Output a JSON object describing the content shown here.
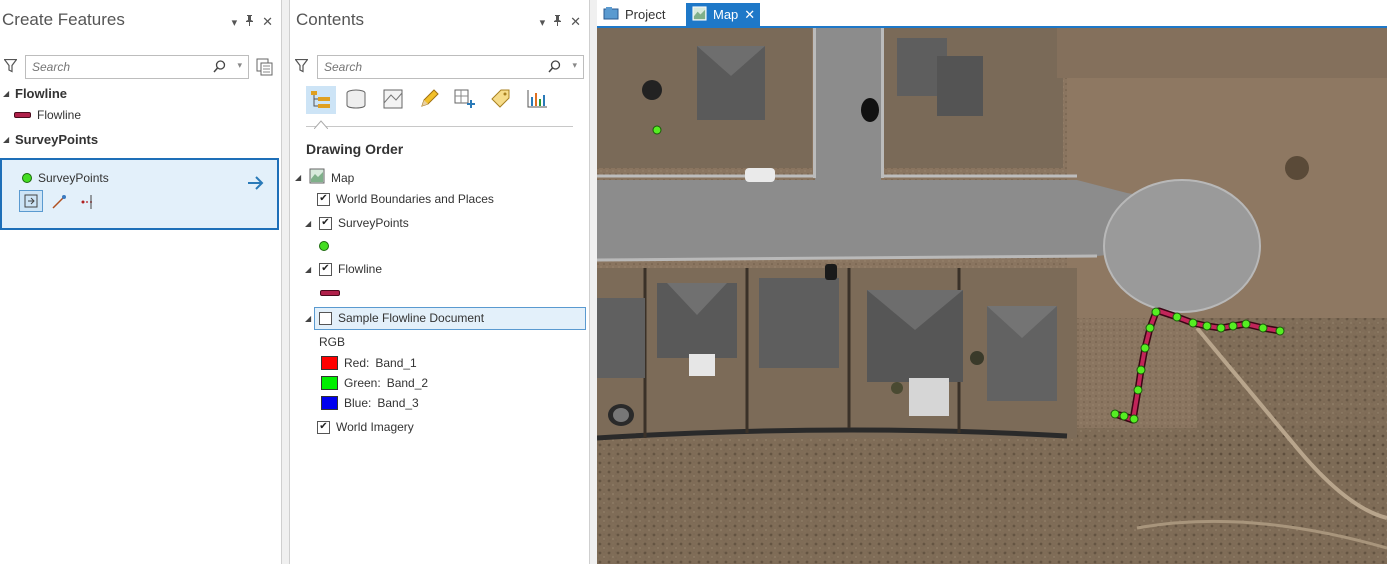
{
  "create_features": {
    "title": "Create Features",
    "search_placeholder": "Search",
    "groups": [
      {
        "name": "Flowline",
        "items": [
          "Flowline"
        ]
      },
      {
        "name": "SurveyPoints"
      }
    ],
    "selected_template": "SurveyPoints"
  },
  "contents": {
    "title": "Contents",
    "search_placeholder": "Search",
    "section": "Drawing Order",
    "map_label": "Map",
    "layers": {
      "world_boundaries": "World Boundaries and Places",
      "survey_points": "SurveyPoints",
      "flowline": "Flowline",
      "sample_doc": "Sample Flowline Document",
      "rgb_label": "RGB",
      "bands": [
        {
          "channel": "Red:",
          "band": "Band_1",
          "color": "#ff0000"
        },
        {
          "channel": "Green:",
          "band": "Band_2",
          "color": "#00ee00"
        },
        {
          "channel": "Blue:",
          "band": "Band_3",
          "color": "#0000ee"
        }
      ],
      "world_imagery": "World Imagery"
    }
  },
  "tabs": {
    "project": "Project",
    "map": "Map"
  },
  "colors": {
    "accent": "#1e78c8",
    "flowline": "#b0204a",
    "survey_point": "#44dd22",
    "selected_bg": "#e3f0fa"
  },
  "icons": [
    "pin-icon",
    "close-icon",
    "filter-icon",
    "search-icon",
    "arrow-right-icon",
    "map-icon",
    "database-icon",
    "pencil-icon",
    "chart-icon"
  ]
}
